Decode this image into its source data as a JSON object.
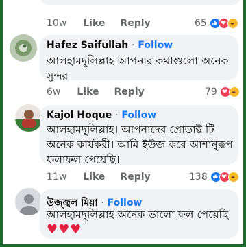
{
  "comments": [
    {
      "text_partial": "কে সাথে কোন একজন পাউডারের পাতলা",
      "time": "10w",
      "like_label": "Like",
      "reply_label": "Reply",
      "reaction_count": "65"
    },
    {
      "author": "Hafez Saifullah",
      "follow_label": "Follow",
      "text_line1": "আলহামদুলিল্লাহ আপনার কথাগুলো অনেক",
      "text_line2": "সুন্দর",
      "time": "6w",
      "like_label": "Like",
      "reply_label": "Reply",
      "reaction_count": "79"
    },
    {
      "author": "Kajol Hoque",
      "follow_label": "Follow",
      "text_line1": "আলহামদুলিল্লাহ। আপনাদের প্রোডাক্ট টি",
      "text_line2": "অনেক কার্যকরী। আমি ইউজ করে আশানুরূপ",
      "text_line3": "ফলাফল পেয়েছি।",
      "time": "11w",
      "like_label": "Like",
      "reply_label": "Reply",
      "reaction_count": "138"
    },
    {
      "author": "উজ্জ্বল মিয়া",
      "follow_label": "Follow",
      "text_line1": "আলহামদুলিল্লাহ অনেক ভালো ফল পেয়েছি",
      "hearts": "♥♥♥"
    }
  ],
  "dot": "·",
  "colors": {
    "link": "#1877f2",
    "secondary_text": "#65676b",
    "bubble_bg": "#f0f2f5",
    "border": "#1d6b2e",
    "heart": "#e41e3f"
  }
}
